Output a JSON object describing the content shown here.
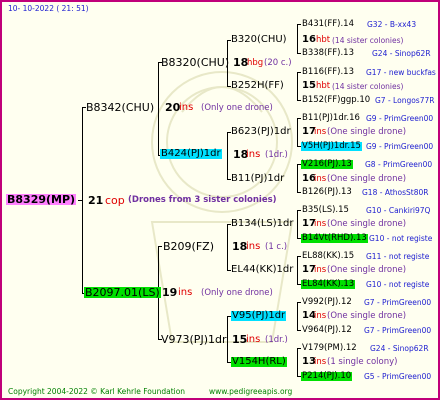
{
  "header": {
    "date_text": "10-  10-2022 (  21:  51)"
  },
  "footer": {
    "copyright": "Copyright 2004-2022 © Karl Kehrle Foundation",
    "site": "www.pedigreeapis.org"
  },
  "colors": {
    "frame_border": "#c0007a",
    "background": "#fffff0",
    "highlight_cyan": "#00e0ff",
    "highlight_green": "#00e000",
    "highlight_magenta": "#ff80ff",
    "watermark": "#e8e8c8"
  },
  "queen": {
    "id": "B8329(MP)",
    "year": "21",
    "suffix": "cop",
    "note": "(Drones from 3 sister colonies)"
  },
  "gen1": {
    "father": {
      "id": "B8342(CHU)",
      "year": "20",
      "suffix": "ins",
      "note": "(Only one drone)"
    },
    "mother": {
      "id": "B2097.01(LS)",
      "year": "19",
      "suffix": "ins",
      "note": "(Only one drone)"
    }
  },
  "gen2": {
    "ff": {
      "id": "B8320(CHU)",
      "year": "18",
      "suffix": "hbg",
      "note": "(20 c.)"
    },
    "fm": {
      "id": "B424(PJ)1dr",
      "year": "18",
      "suffix": "ins",
      "note": "(1dr.)"
    },
    "mf": {
      "id": "B209(FZ)",
      "year": "18",
      "suffix": "ins",
      "note": "(1 c.)"
    },
    "mm": {
      "id": "V973(PJ)1dr",
      "year": "15",
      "suffix": "ins",
      "note": "(1dr.)"
    }
  },
  "gen3": {
    "fff": {
      "id": "B320(CHU)",
      "year": "16",
      "suffix": "hbt",
      "note": "(14 sister colonies)"
    },
    "ffm": {
      "id": "B252H(FF)",
      "year": "15",
      "suffix": "hbt",
      "note": "(14 sister colonies)"
    },
    "fmf": {
      "id": "B623(PJ)1dr",
      "year": "17",
      "suffix": "ins",
      "note": "(One single drone)"
    },
    "fmm": {
      "id": "B11(PJ)1dr",
      "year": "16",
      "suffix": "ins",
      "note": "(One single drone)"
    },
    "mff": {
      "id": "B134(LS)1dr",
      "year": "17",
      "suffix": "ins",
      "note": "(One single drone)"
    },
    "mfm": {
      "id": "EL44(KK)1dr",
      "year": "17",
      "suffix": "ins",
      "note": "(One single drone)"
    },
    "mmf": {
      "id": "V95(PJ)1dr",
      "year": "14",
      "suffix": "ins",
      "note": "(One single drone)"
    },
    "mmm": {
      "id": "V154H(RL)",
      "year": "13",
      "suffix": "ins",
      "note": "(1 single colony)"
    }
  },
  "gen4": [
    {
      "id": "B431(FF).14",
      "note": "G32 - B-xx43"
    },
    {
      "id": "B338(FF).13",
      "note": "G24 - Sinop62R"
    },
    {
      "id": "B116(FF).13",
      "note": "G17 - new buckfas"
    },
    {
      "id": "B152(FF)ggp.10",
      "note": "G7 - Longos77R"
    },
    {
      "id": "B11(PJ)1dr.16",
      "note": "G9 - PrimGreen00"
    },
    {
      "id": "V5H(PJ)1dr.15",
      "note": "G9 - PrimGreen00"
    },
    {
      "id": "V216(PJ).13",
      "note": "G8 - PrimGreen00"
    },
    {
      "id": "B126(PJ).13",
      "note": "G18 - AthosSt80R"
    },
    {
      "id": "B35(LS).15",
      "note": "G10 - Cankiri97Q"
    },
    {
      "id": "B14Vt(RHD).13",
      "note": "G10 - not registe"
    },
    {
      "id": "EL88(KK).15",
      "note": "G11 - not registe"
    },
    {
      "id": "EL84(KK).13",
      "note": "G10 - not registe"
    },
    {
      "id": "V992(PJ).12",
      "note": "G7 - PrimGreen00"
    },
    {
      "id": "V964(PJ).12",
      "note": "G7 - PrimGreen00"
    },
    {
      "id": "V179(PM).12",
      "note": "G24 - Sinop62R"
    },
    {
      "id": "P214(PJ).10",
      "note": "G5 - PrimGreen00"
    }
  ]
}
